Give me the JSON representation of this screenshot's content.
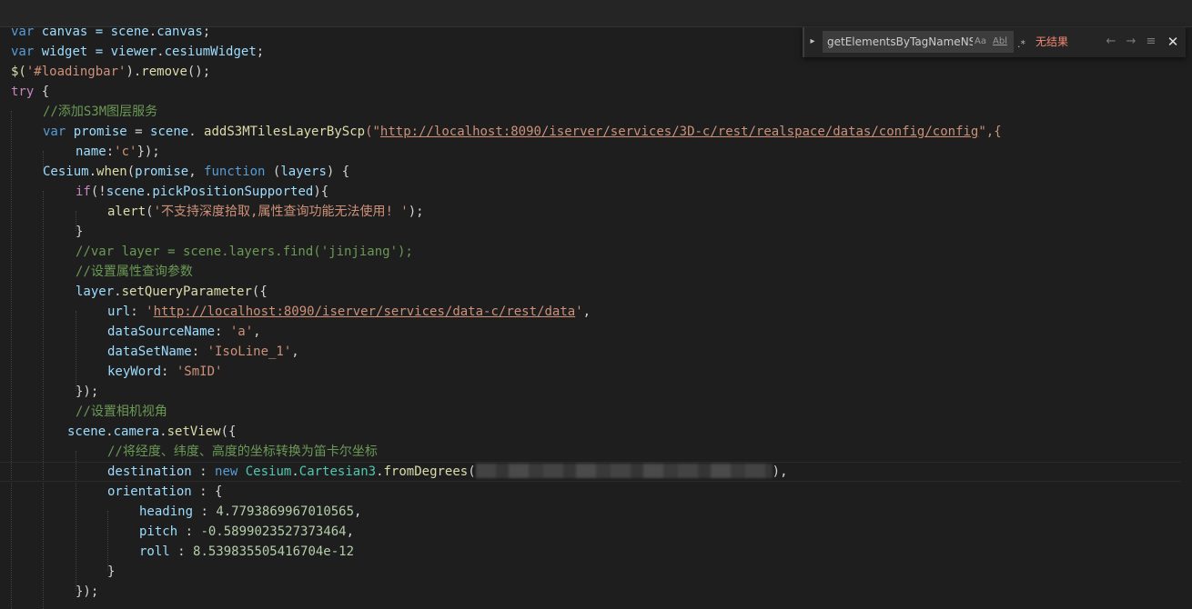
{
  "find_widget": {
    "query": "getElementsByTagNameNS",
    "match_case_label": "Aa",
    "whole_word_label": "Abl",
    "regex_label": ".*",
    "result_text": "无结果",
    "toggle_icon": "chevron-right-icon",
    "prev_icon": "arrow-left-icon",
    "next_icon": "arrow-right-icon",
    "selection_icon": "find-in-selection-icon",
    "close_icon": "close-icon"
  },
  "code": {
    "l0_a": "var",
    "l0_b": " canvas = ",
    "l0_c": "scene",
    "l0_d": ".",
    "l0_e": "canvas",
    "l0_f": ";",
    "l1_a": "var",
    "l1_b": " widget = ",
    "l1_c": "viewer",
    "l1_d": ".",
    "l1_e": "cesiumWidget",
    "l1_f": ";",
    "l2_a": "$(",
    "l2_b": "'#loadingbar'",
    "l2_c": ").",
    "l2_d": "remove",
    "l2_e": "();",
    "l3_a": "try",
    "l3_b": " {",
    "l4_a": "//添加S3M图层服务",
    "l5_a": "var",
    "l5_b": " promise",
    "l5_c": " = ",
    "l5_d": "scene",
    "l5_e": ". ",
    "l5_f": "addS3MTilesLayerByScp",
    "l5_g": "(\"",
    "l5_h": "http://localhost:8090/iserver/services/3D-c/rest/realspace/datas/config/config",
    "l5_i": "\",{",
    "l6_a": "name",
    "l6_b": ":",
    "l6_c": "'c'",
    "l6_d": "});",
    "l7_a": "Cesium",
    "l7_b": ".",
    "l7_c": "when",
    "l7_d": "(",
    "l7_e": "promise",
    "l7_f": ", ",
    "l7_g": "function",
    "l7_h": " (",
    "l7_i": "layers",
    "l7_j": ") {",
    "l8_a": "if",
    "l8_b": "(!",
    "l8_c": "scene",
    "l8_d": ".",
    "l8_e": "pickPositionSupported",
    "l8_f": "){",
    "l9_a": "alert",
    "l9_b": "(",
    "l9_c": "'不支持深度拾取,属性查询功能无法使用! '",
    "l9_d": ");",
    "l10_a": "}",
    "l11_a": "//var layer = scene.layers.find('jinjiang');",
    "l12_a": "//设置属性查询参数",
    "l13_a": "layer",
    "l13_b": ".",
    "l13_c": "setQueryParameter",
    "l13_d": "({",
    "l14_a": "url",
    "l14_b": ": ",
    "l14_c": "'",
    "l14_d": "http://localhost:8090/iserver/services/data-c/rest/data",
    "l14_e": "'",
    "l14_f": ",",
    "l15_a": "dataSourceName",
    "l15_b": ": ",
    "l15_c": "'a'",
    "l15_d": ",",
    "l16_a": "dataSetName",
    "l16_b": ": ",
    "l16_c": "'IsoLine_1'",
    "l16_d": ",",
    "l17_a": "keyWord",
    "l17_b": ": ",
    "l17_c": "'SmID'",
    "l18_a": "});",
    "l19_a": "//设置相机视角",
    "l20_a": "scene",
    "l20_b": ".",
    "l20_c": "camera",
    "l20_d": ".",
    "l20_e": "setView",
    "l20_f": "({",
    "l21_a": "//将经度、纬度、高度的坐标转换为笛卡尔坐标",
    "l22_a": "destination",
    "l22_b": " : ",
    "l22_c": "new",
    "l22_d": " ",
    "l22_e": "Cesium",
    "l22_f": ".",
    "l22_g": "Cartesian3",
    "l22_h": ".",
    "l22_i": "fromDegrees",
    "l22_j": "(",
    "l22_k": "),",
    "l23_a": "orientation",
    "l23_b": " : {",
    "l24_a": "heading",
    "l24_b": " : ",
    "l24_c": "4.7793869967010565",
    "l24_d": ",",
    "l25_a": "pitch",
    "l25_b": " : ",
    "l25_c": "-0.5899023527373464",
    "l25_d": ",",
    "l26_a": "roll",
    "l26_b": " : ",
    "l26_c": "8.539835505416704e-12",
    "l27_a": "}",
    "l28_a": "});"
  }
}
